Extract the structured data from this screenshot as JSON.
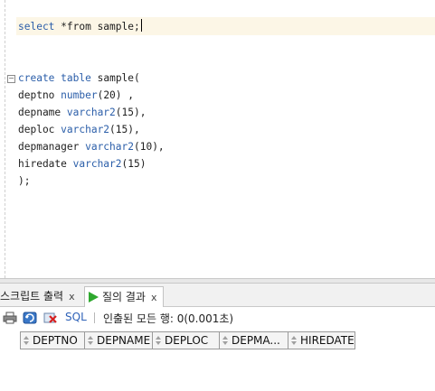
{
  "editor": {
    "line1": {
      "kw1": "select",
      "rest": " *from sample;"
    },
    "create": {
      "kw_create": "create",
      "kw_table": "table",
      "name": "sample(",
      "rows": [
        {
          "col": "deptno ",
          "type": "number",
          "size": "(20) ,"
        },
        {
          "col": "depname ",
          "type": "varchar2",
          "size": "(15),"
        },
        {
          "col": "deploc ",
          "type": "varchar2",
          "size": "(15),"
        },
        {
          "col": "depmanager ",
          "type": "varchar2",
          "size": "(10),"
        },
        {
          "col": "hiredate ",
          "type": "varchar2",
          "size": "(15)"
        }
      ],
      "close": ");"
    }
  },
  "tabs": {
    "script_output": {
      "label": "스크립트 출력",
      "close": "x"
    },
    "query_result": {
      "label": "질의 결과",
      "close": "x"
    }
  },
  "toolbar": {
    "print_icon": "printer-icon",
    "refresh_icon": "refresh-icon",
    "cancel_icon": "cancel-icon",
    "sql_label": "SQL",
    "status": "인출된 모든 행: 0(0.001초)"
  },
  "grid": {
    "columns": [
      "DEPTNO",
      "DEPNAME",
      "DEPLOC",
      "DEPMA...",
      "HIREDATE"
    ]
  },
  "colors": {
    "keyword": "#2b5ea9",
    "current_line": "#fcf6e6",
    "play": "#2ea82e"
  }
}
